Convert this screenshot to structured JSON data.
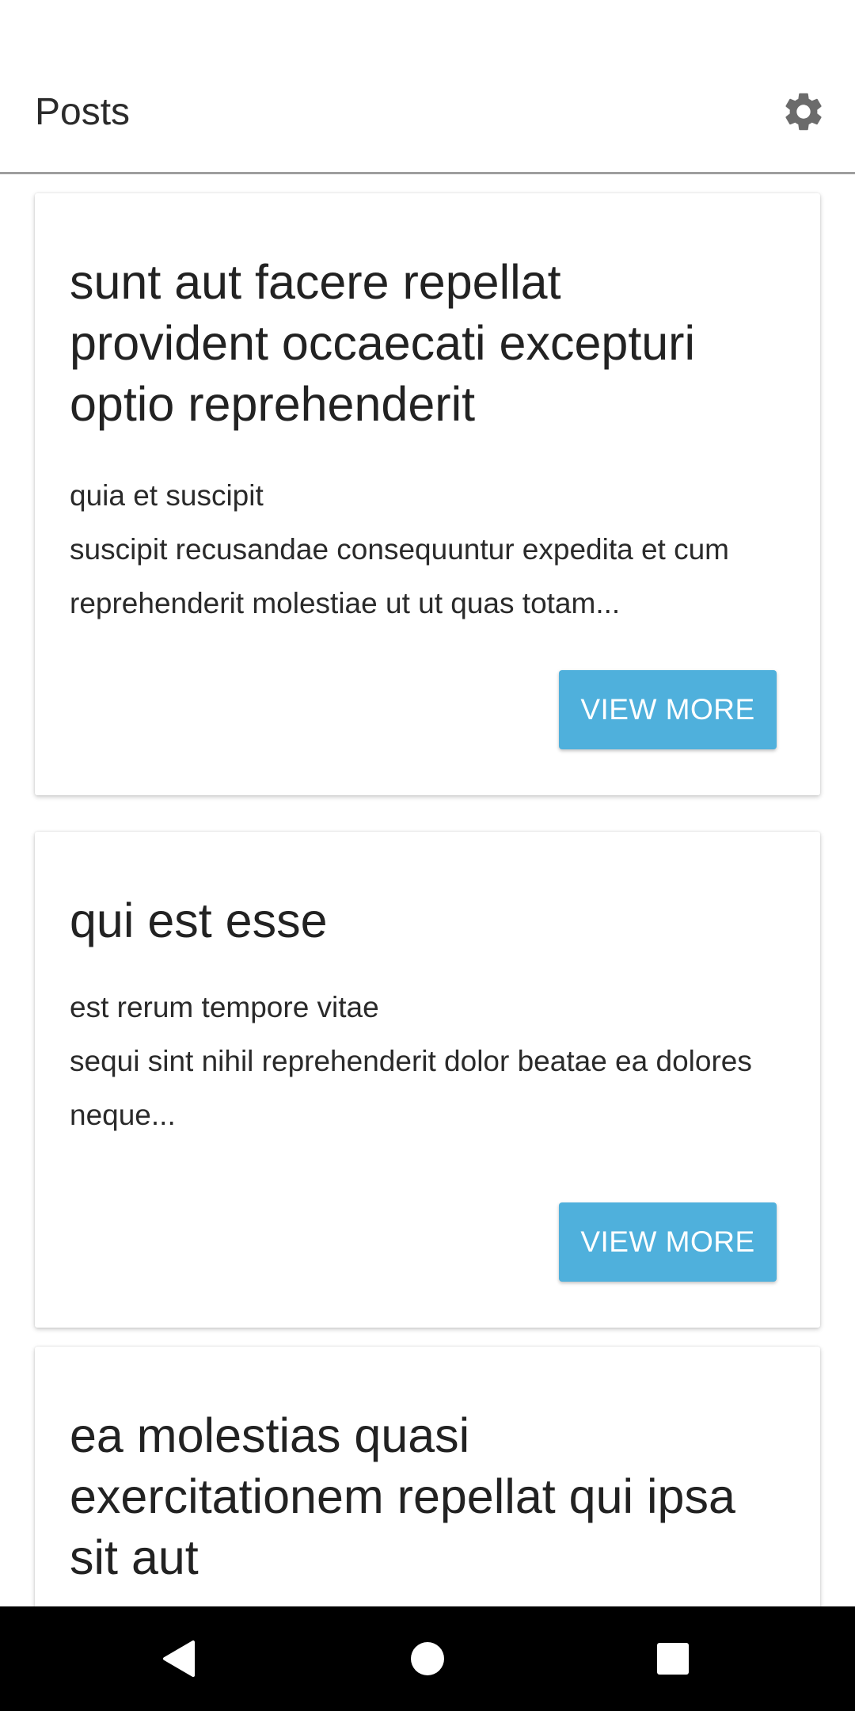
{
  "app_bar": {
    "title": "Posts",
    "settings_icon": "gear-icon"
  },
  "posts": [
    {
      "title": "sunt aut facere repellat provident occaecati excepturi optio reprehenderit",
      "body": "quia et suscipit\nsuscipit recusandae consequuntur expedita et cum reprehenderit molestiae ut ut quas totam...",
      "button_label": "VIEW MORE"
    },
    {
      "title": "qui est esse",
      "body": "est rerum tempore vitae\nsequi sint nihil reprehenderit dolor beatae ea dolores neque...",
      "button_label": "VIEW MORE"
    },
    {
      "title": "ea molestias quasi exercitationem repellat qui ipsa sit aut"
    }
  ],
  "colors": {
    "accent": "#4fb0dc",
    "divider": "#9e9e9e",
    "nav_background": "#000000"
  },
  "nav_bar": {
    "icons": [
      "back-icon",
      "home-icon",
      "recents-icon"
    ]
  }
}
